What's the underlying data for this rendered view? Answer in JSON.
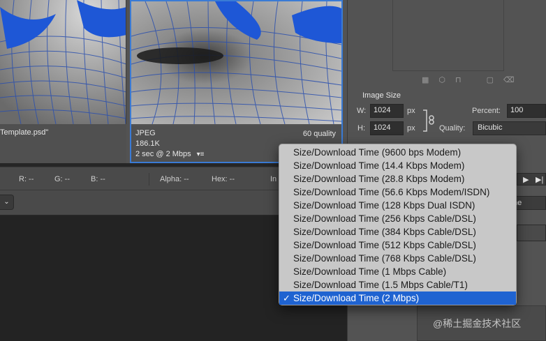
{
  "left_pane": {
    "filename": "Template.psd\""
  },
  "right_pane": {
    "format": "JPEG",
    "size": "186.1K",
    "time": "2 sec @ 2 Mbps",
    "quality": "60 quality",
    "menu_icon": "▾≡"
  },
  "image_size": {
    "title": "Image Size",
    "w_label": "W:",
    "w_value": "1024",
    "w_unit": "px",
    "h_label": "H:",
    "h_value": "1024",
    "h_unit": "px",
    "percent_label": "Percent:",
    "percent_value": "100",
    "quality_label": "Quality:",
    "quality_value": "Bicubic"
  },
  "status": {
    "r": "R: --",
    "g": "G: --",
    "b": "B: --",
    "alpha": "Alpha: --",
    "hex": "Hex: --",
    "index": "In"
  },
  "right_stub": {
    "partial_label": "ne"
  },
  "menu": {
    "items": [
      "Size/Download Time (9600 bps Modem)",
      "Size/Download Time (14.4 Kbps Modem)",
      "Size/Download Time (28.8 Kbps Modem)",
      "Size/Download Time (56.6 Kbps Modem/ISDN)",
      "Size/Download Time (128 Kbps Dual ISDN)",
      "Size/Download Time (256 Kbps Cable/DSL)",
      "Size/Download Time (384 Kbps Cable/DSL)",
      "Size/Download Time (512 Kbps Cable/DSL)",
      "Size/Download Time (768 Kbps Cable/DSL)",
      "Size/Download Time (1 Mbps Cable)",
      "Size/Download Time (1.5 Mbps Cable/T1)",
      "Size/Download Time (2 Mbps)"
    ],
    "selected_index": 11,
    "check_glyph": "✓"
  },
  "watermark": "@稀土掘金技术社区",
  "colors": {
    "accent": "#1f63d1",
    "selection_border": "#3a7bd5"
  }
}
